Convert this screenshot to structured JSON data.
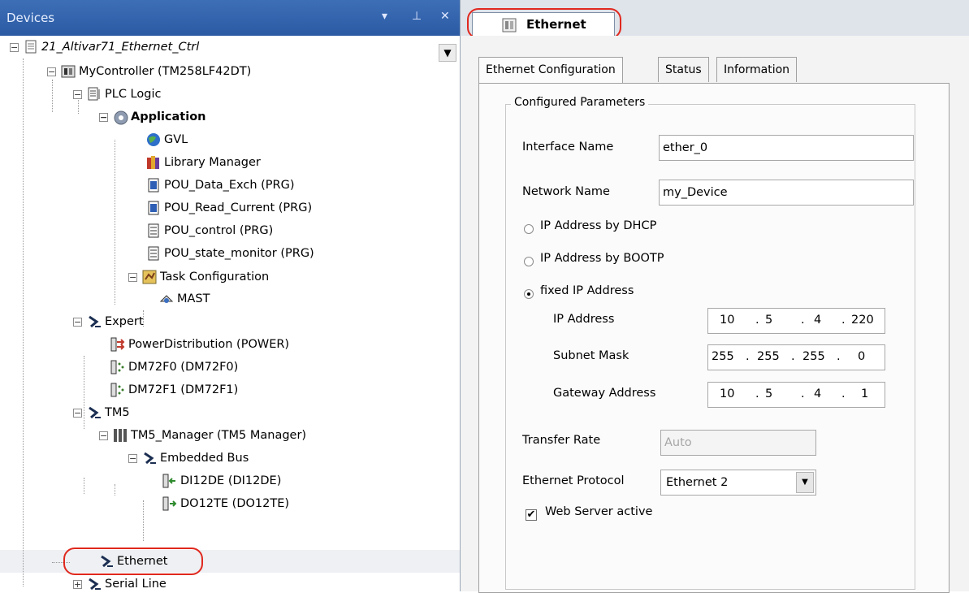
{
  "devices_pane": {
    "title": "Devices",
    "controls": {
      "dropdown": "▾",
      "pin": "⊥",
      "close": "✕"
    },
    "tree": [
      {
        "label": "21_Altivar71_Ethernet_Ctrl"
      },
      {
        "label": "MyController (TM258LF42DT)"
      },
      {
        "label": "PLC Logic"
      },
      {
        "label": "Application"
      },
      {
        "label": "GVL"
      },
      {
        "label": "Library Manager"
      },
      {
        "label": "POU_Data_Exch (PRG)"
      },
      {
        "label": "POU_Read_Current (PRG)"
      },
      {
        "label": "POU_control (PRG)"
      },
      {
        "label": "POU_state_monitor (PRG)"
      },
      {
        "label": "Task Configuration"
      },
      {
        "label": "MAST"
      },
      {
        "label": "Expert"
      },
      {
        "label": "PowerDistribution (POWER)"
      },
      {
        "label": "DM72F0 (DM72F0)"
      },
      {
        "label": "DM72F1 (DM72F1)"
      },
      {
        "label": "TM5"
      },
      {
        "label": "TM5_Manager (TM5 Manager)"
      },
      {
        "label": "Embedded Bus"
      },
      {
        "label": "DI12DE (DI12DE)"
      },
      {
        "label": "DO12TE (DO12TE)"
      },
      {
        "label": "Ethernet"
      },
      {
        "label": "Serial Line"
      }
    ]
  },
  "editor": {
    "doc_tab": "Ethernet",
    "tabs": [
      "Ethernet Configuration",
      "Status",
      "Information"
    ],
    "group_title": "Configured Parameters",
    "interface_name_label": "Interface Name",
    "interface_name_value": "ether_0",
    "network_name_label": "Network Name",
    "network_name_value": "my_Device",
    "radio_dhcp": "IP Address by DHCP",
    "radio_bootp": "IP Address by BOOTP",
    "radio_fixed": "fixed IP Address",
    "ip_label": "IP Address",
    "ip": [
      "10",
      "5",
      "4",
      "220"
    ],
    "subnet_label": "Subnet Mask",
    "subnet": [
      "255",
      "255",
      "255",
      "0"
    ],
    "gateway_label": "Gateway Address",
    "gateway": [
      "10",
      "5",
      "4",
      "1"
    ],
    "transfer_rate_label": "Transfer Rate",
    "transfer_rate_value": "Auto",
    "protocol_label": "Ethernet Protocol",
    "protocol_value": "Ethernet 2",
    "web_server_label": "Web Server active",
    "web_server_checked": "✔"
  },
  "colors": {
    "highlight_oval": "#e0281e",
    "title_bar": "#2b5aa3"
  }
}
